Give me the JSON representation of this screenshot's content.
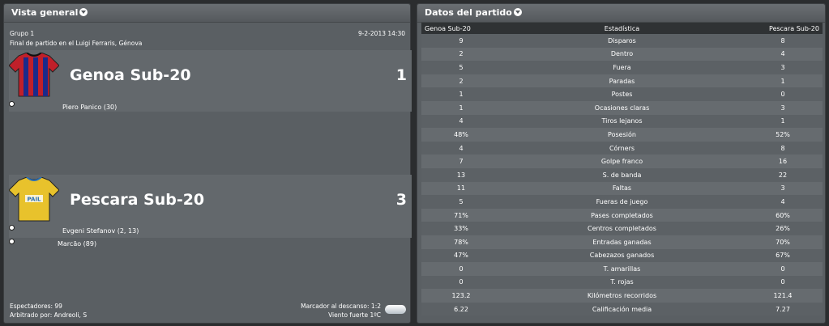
{
  "overview": {
    "title": "Vista general",
    "group": "Grupo 1",
    "date": "9-2-2013 14:30",
    "venue": "Final de partido en el Luigi Ferraris, Génova",
    "home": {
      "name": "Genoa Sub-20",
      "score": "1",
      "kit_colors": [
        "#c0202a",
        "#1c2a8a"
      ],
      "scorers": [
        "Piero Panico (30)"
      ]
    },
    "away": {
      "name": "Pescara Sub-20",
      "score": "3",
      "kit_colors": [
        "#e8c22c",
        "#2a6fb5"
      ],
      "kit_text": "PAIL",
      "scorers": [
        "Evgeni Stefanov (2, 13)",
        "Marcão (89)"
      ]
    },
    "spectators": "Espectadores: 99",
    "referee": "Arbitrado por: Andreoli, S",
    "halftime": "Marcador al descanso: 1:2",
    "weather": "Viento fuerte 1ºC",
    "weather_icon": "cloud-icon"
  },
  "match_data": {
    "title": "Datos del partido",
    "headers": [
      "Genoa Sub-20",
      "Estadística",
      "Pescara Sub-20"
    ],
    "rows": [
      {
        "home": "9",
        "stat": "Disparos",
        "away": "8"
      },
      {
        "home": "2",
        "stat": "Dentro",
        "away": "4"
      },
      {
        "home": "5",
        "stat": "Fuera",
        "away": "3"
      },
      {
        "home": "2",
        "stat": "Paradas",
        "away": "1"
      },
      {
        "home": "1",
        "stat": "Postes",
        "away": "0"
      },
      {
        "home": "1",
        "stat": "Ocasiones claras",
        "away": "3"
      },
      {
        "home": "4",
        "stat": "Tiros lejanos",
        "away": "1"
      },
      {
        "home": "48%",
        "stat": "Posesión",
        "away": "52%"
      },
      {
        "home": "4",
        "stat": "Córners",
        "away": "8"
      },
      {
        "home": "7",
        "stat": "Golpe franco",
        "away": "16"
      },
      {
        "home": "13",
        "stat": "S. de banda",
        "away": "22"
      },
      {
        "home": "11",
        "stat": "Faltas",
        "away": "3"
      },
      {
        "home": "5",
        "stat": "Fueras de juego",
        "away": "4"
      },
      {
        "home": "71%",
        "stat": "Pases completados",
        "away": "60%"
      },
      {
        "home": "33%",
        "stat": "Centros completados",
        "away": "26%"
      },
      {
        "home": "78%",
        "stat": "Entradas ganadas",
        "away": "70%"
      },
      {
        "home": "47%",
        "stat": "Cabezazos ganados",
        "away": "67%"
      },
      {
        "home": "0",
        "stat": "T. amarillas",
        "away": "0"
      },
      {
        "home": "0",
        "stat": "T. rojas",
        "away": "0"
      },
      {
        "home": "123.2",
        "stat": "Kilómetros recorridos",
        "away": "121.4"
      },
      {
        "home": "6.22",
        "stat": "Calificación media",
        "away": "7.27"
      }
    ]
  }
}
